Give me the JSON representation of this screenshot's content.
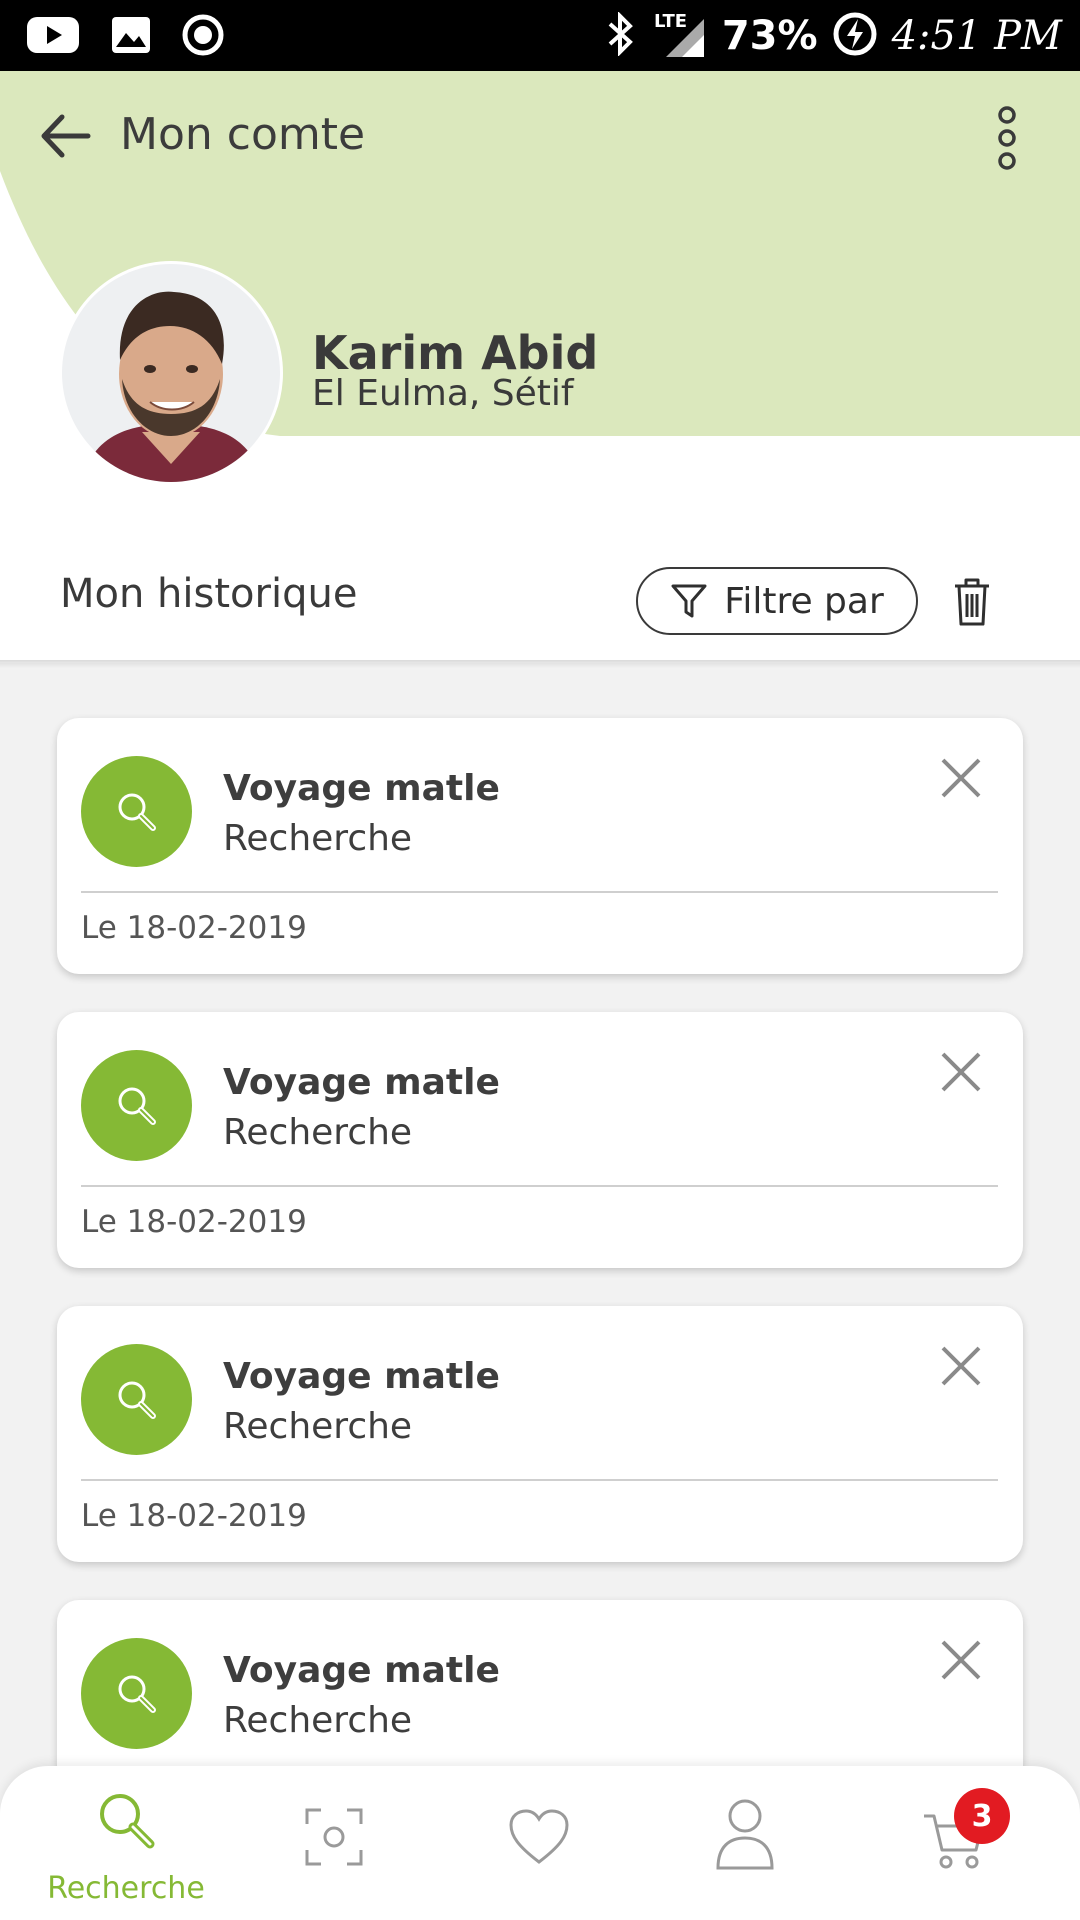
{
  "status_bar": {
    "battery_percent": "73%",
    "time": "4:51 PM",
    "network": "LTE",
    "icons": [
      "youtube-icon",
      "gallery-icon",
      "record-icon",
      "bluetooth-icon",
      "signal-icon",
      "battery-charging-icon"
    ]
  },
  "header": {
    "title": "Mon comte",
    "accent_color": "#dbe8bd"
  },
  "profile": {
    "name": "Karim Abid",
    "location": "El Eulma, Sétif"
  },
  "history": {
    "title": "Mon historique",
    "filter_label": "Filtre par",
    "items": [
      {
        "title": "Voyage matle",
        "subtitle": "Recherche",
        "date": "Le 18-02-2019"
      },
      {
        "title": "Voyage matle",
        "subtitle": "Recherche",
        "date": "Le 18-02-2019"
      },
      {
        "title": "Voyage matle",
        "subtitle": "Recherche",
        "date": "Le 18-02-2019"
      },
      {
        "title": "Voyage matle",
        "subtitle": "Recherche",
        "date": ""
      }
    ]
  },
  "bottom_nav": {
    "items": [
      {
        "icon": "search-icon",
        "label": "Recherche",
        "active": true
      },
      {
        "icon": "scan-icon",
        "label": "",
        "active": false
      },
      {
        "icon": "heart-icon",
        "label": "",
        "active": false
      },
      {
        "icon": "profile-icon",
        "label": "",
        "active": false
      },
      {
        "icon": "cart-icon",
        "label": "",
        "active": false
      }
    ],
    "cart_badge": "3"
  },
  "colors": {
    "brand_green": "#85b935",
    "header_green": "#dbe8bd",
    "badge_red": "#e21b22"
  }
}
